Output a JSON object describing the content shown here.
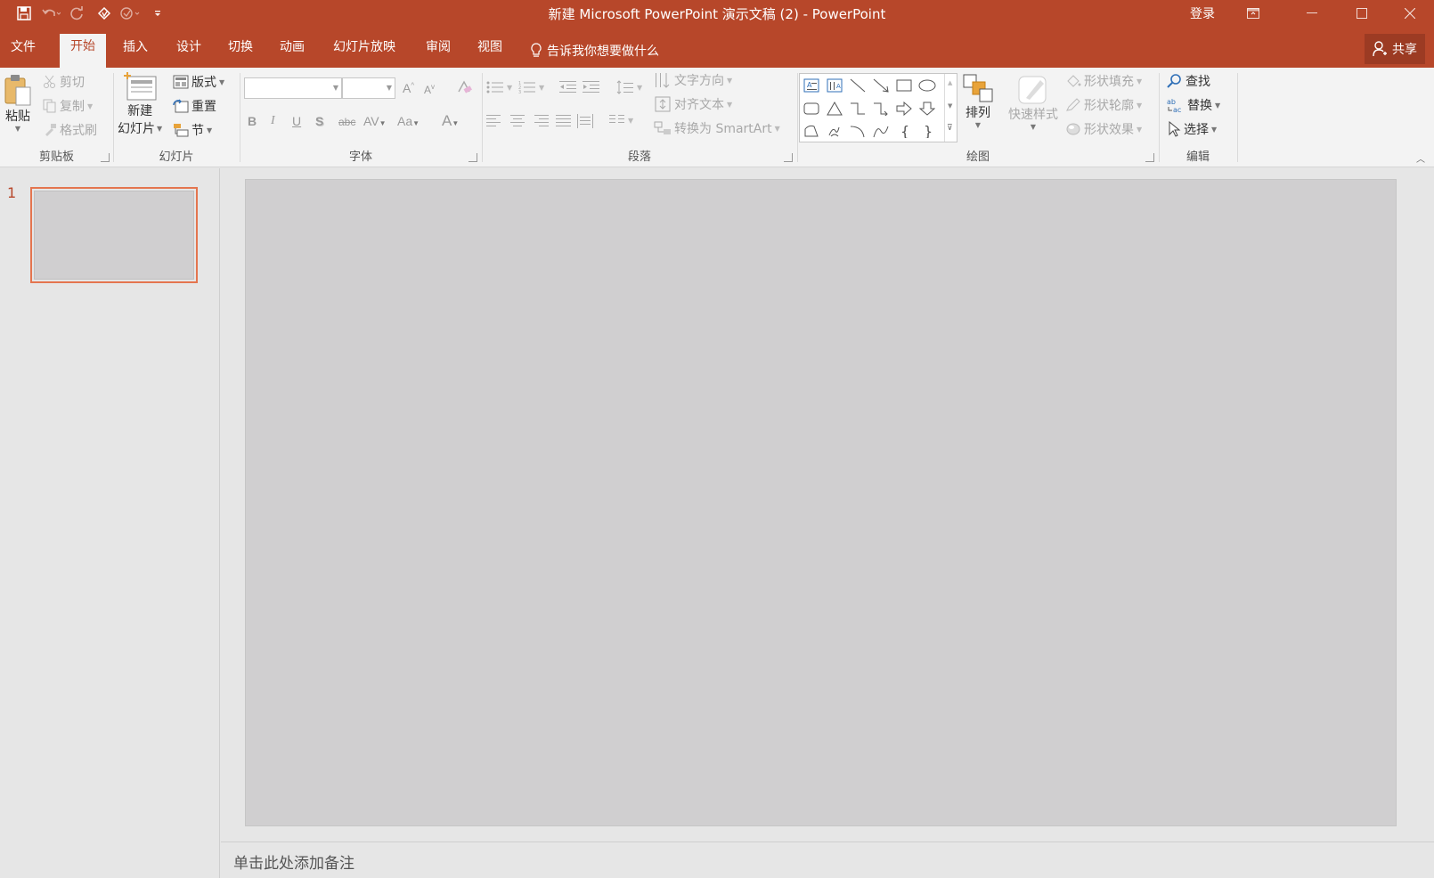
{
  "titlebar": {
    "title": "新建 Microsoft PowerPoint 演示文稿 (2)  -  PowerPoint",
    "login": "登录"
  },
  "tabs": [
    "文件",
    "开始",
    "插入",
    "设计",
    "切换",
    "动画",
    "幻灯片放映",
    "审阅",
    "视图"
  ],
  "active_tab": "开始",
  "tellme": "告诉我你想要做什么",
  "share": "共享",
  "ribbon": {
    "clipboard": {
      "label": "剪贴板",
      "paste": "粘贴",
      "cut": "剪切",
      "copy": "复制",
      "format_painter": "格式刷"
    },
    "slides": {
      "label": "幻灯片",
      "new_slide_1": "新建",
      "new_slide_2": "幻灯片",
      "layout": "版式",
      "reset": "重置",
      "section": "节"
    },
    "font": {
      "label": "字体",
      "font_name": "",
      "font_size": "",
      "bold": "B",
      "italic": "I",
      "underline": "U",
      "shadow": "S",
      "strike": "abc",
      "spacing": "AV",
      "case": "Aa",
      "color": "A"
    },
    "paragraph": {
      "label": "段落",
      "text_direction": "文字方向",
      "align_text": "对齐文本",
      "smartart": "转换为 SmartArt"
    },
    "drawing": {
      "label": "绘图",
      "arrange": "排列",
      "quick_styles": "快速样式",
      "shape_fill": "形状填充",
      "shape_outline": "形状轮廓",
      "shape_effects": "形状效果"
    },
    "editing": {
      "label": "编辑",
      "find": "查找",
      "replace": "替换",
      "select": "选择"
    }
  },
  "slides_panel": {
    "slide_number": "1"
  },
  "notes": {
    "placeholder": "单击此处添加备注"
  },
  "colors": {
    "accent": "#b7472a",
    "thumb_border": "#e4754f",
    "slide_fill": "#d0cfd0"
  }
}
